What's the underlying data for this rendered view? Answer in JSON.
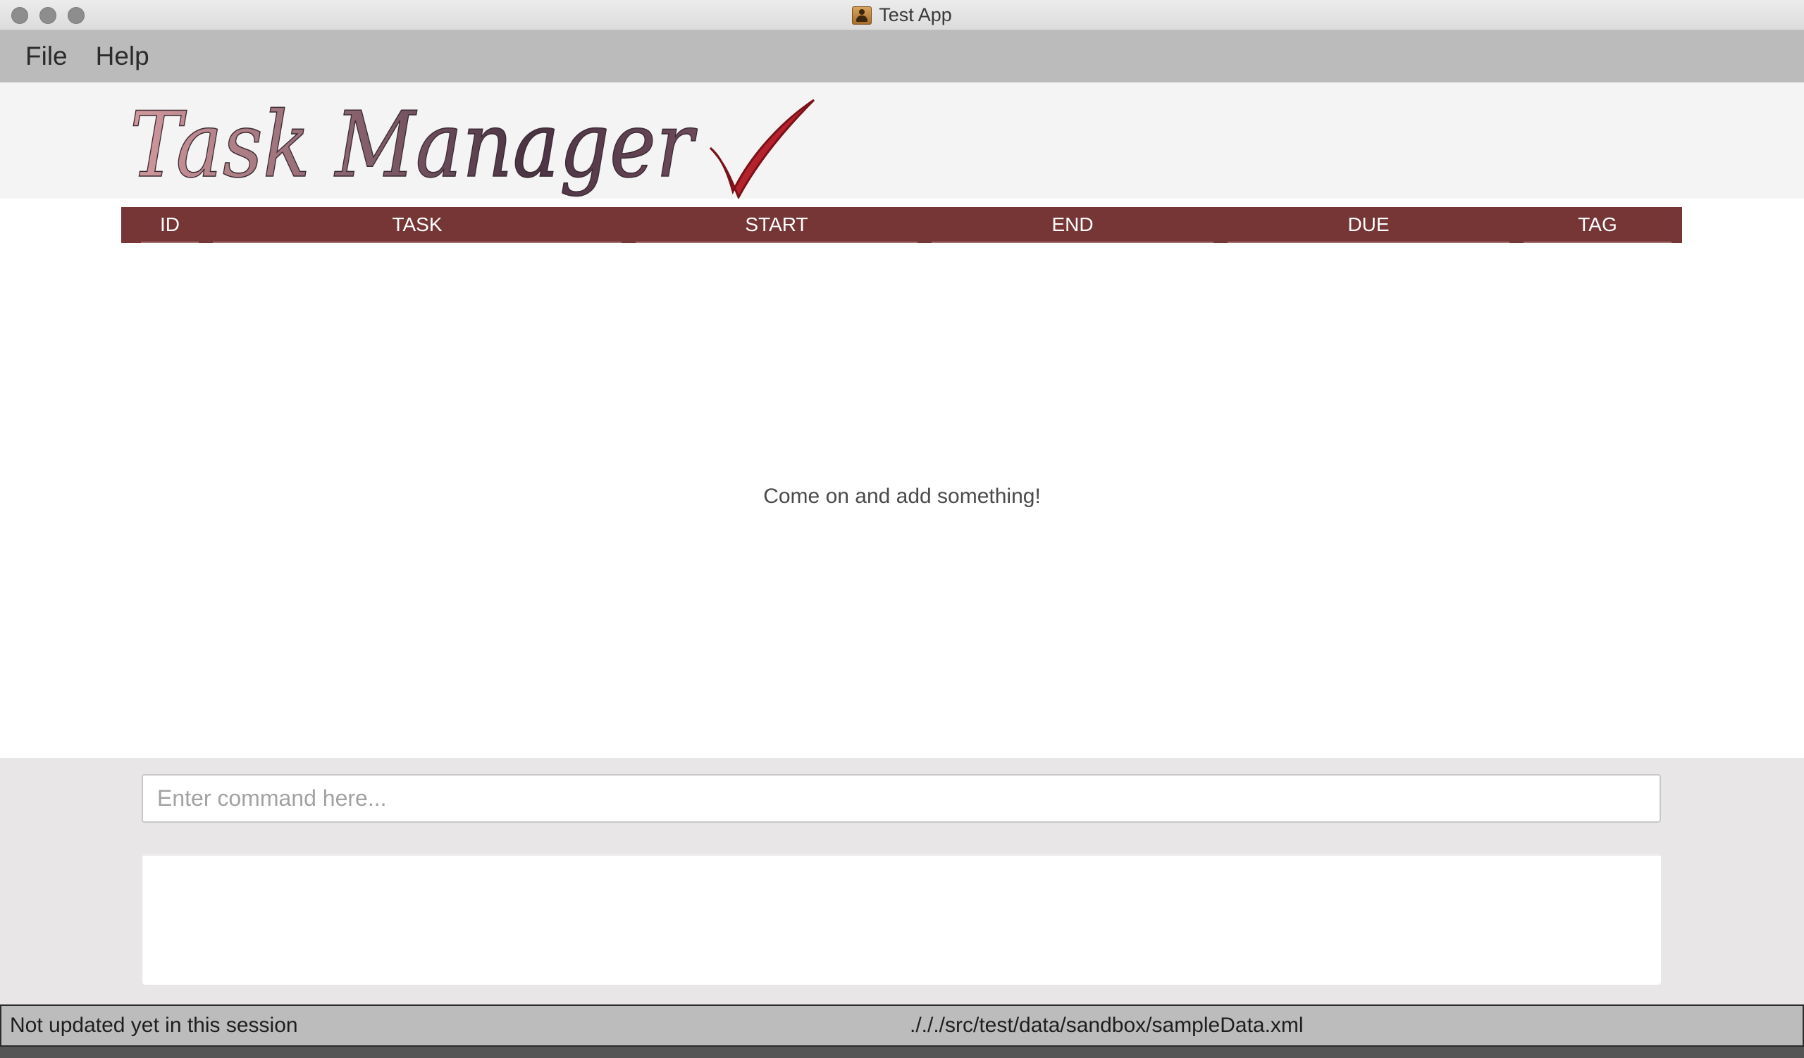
{
  "window": {
    "title": "Test App",
    "icon": "contacts-app-icon"
  },
  "menu": {
    "items": [
      "File",
      "Help"
    ]
  },
  "logo": {
    "text": "Task Manager",
    "icon": "checkmark-icon",
    "colors": {
      "text": "#b07a7f",
      "check": "#b5212c"
    }
  },
  "table": {
    "header_color": "#763636",
    "columns": [
      "ID",
      "TASK",
      "START",
      "END",
      "DUE",
      "TAG"
    ],
    "rows": [],
    "empty_message": "Come on and add something!"
  },
  "command": {
    "placeholder": "Enter command here...",
    "value": ""
  },
  "result": {
    "text": ""
  },
  "status": {
    "sync": "Not updated yet in this session",
    "file_path": "./././src/test/data/sandbox/sampleData.xml"
  }
}
